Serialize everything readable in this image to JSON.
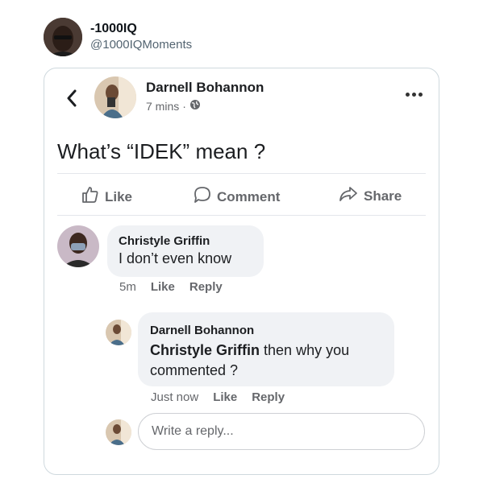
{
  "tweet": {
    "display_name": "-1000IQ",
    "handle": "@1000IQMoments"
  },
  "post": {
    "author": "Darnell Bohannon",
    "time": "7 mins",
    "separator": "·",
    "text": "What’s “IDEK” mean ?",
    "actions": {
      "like": "Like",
      "comment": "Comment",
      "share": "Share"
    }
  },
  "comments": [
    {
      "author": "Christyle Griffin",
      "text": "I don’t even know",
      "time": "5m",
      "like": "Like",
      "reply": "Reply"
    },
    {
      "author": "Darnell Bohannon",
      "mention": "Christyle Griffin",
      "text": " then why you commented ?",
      "time": "Just now",
      "like": "Like",
      "reply": "Reply"
    }
  ],
  "reply_box": {
    "placeholder": "Write a reply..."
  },
  "colors": {
    "secondary_text": "#65676b",
    "bubble": "#f0f2f5",
    "border": "#cfd9de"
  },
  "icons": [
    "back-chevron-icon",
    "globe-icon",
    "more-dots-icon",
    "thumbs-up-icon",
    "comment-icon",
    "share-arrow-icon"
  ]
}
